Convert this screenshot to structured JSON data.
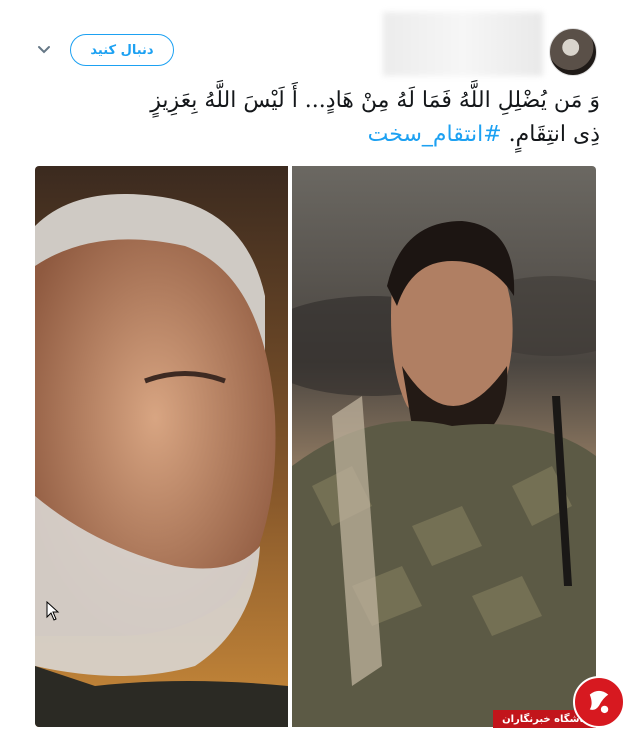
{
  "header": {
    "follow_label": "دنبال کنید"
  },
  "tweet": {
    "line1": "وَ مَن يُضْلِلِ اللَّهُ فَمَا لَهُ مِنْ هَادٍ... أَ لَيْسَ اللَّهُ بِعَزِيزٍ",
    "line2": "ذِى انتِقَامٍ.",
    "hashtag": "#انتقام_سخت"
  },
  "watermark": {
    "label": "باشگاه خبرنگاران"
  },
  "icons": {
    "avatar": "avatar",
    "more": "chevron-down-icon",
    "cursor": "mouse-cursor-icon",
    "logo": "news-agency-logo"
  },
  "colors": {
    "accent": "#1da1f2",
    "text": "#14171a",
    "watermark_red": "#c2151b"
  }
}
